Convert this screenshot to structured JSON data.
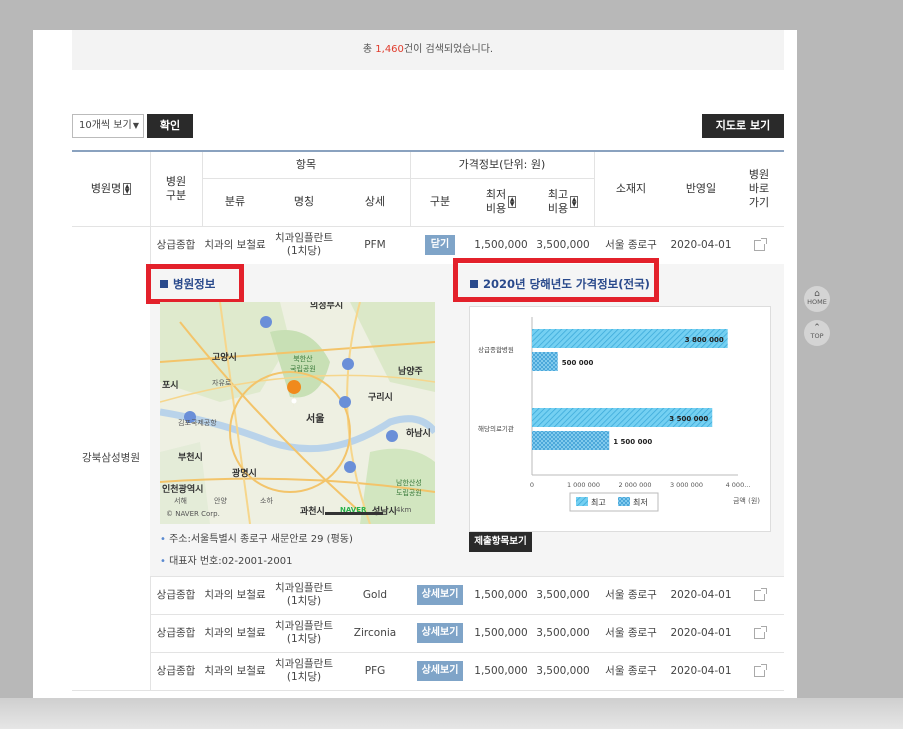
{
  "summary": {
    "prefix": "총 ",
    "count": "1,460",
    "suffix": "건이 검색되었습니다."
  },
  "toolbar": {
    "select_value": "10개씩 보기",
    "confirm_label": "확인",
    "map_view_label": "지도로 보기"
  },
  "table": {
    "headers": {
      "hospital": "병원명",
      "type": "병원\n구분",
      "item": "항목",
      "category": "분류",
      "name": "명칭",
      "detail": "상세",
      "price_info": "가격정보(단위: 원)",
      "division": "구분",
      "min": "최저\n비용",
      "max": "최고\n비용",
      "location": "소재지",
      "date": "반영일",
      "link": "병원\n바로\n가기"
    },
    "hospital_name": "강북삼성병원",
    "rows": [
      {
        "type": "상급종합",
        "category": "치과의 보철료",
        "name": "치과임플란트\n(1치당)",
        "detail": "PFM",
        "button": "닫기",
        "min": "1,500,000",
        "max": "3,500,000",
        "location": "서울 종로구",
        "date": "2020-04-01"
      },
      {
        "type": "상급종합",
        "category": "치과의 보철료",
        "name": "치과임플란트\n(1치당)",
        "detail": "Gold",
        "button": "상세보기",
        "min": "1,500,000",
        "max": "3,500,000",
        "location": "서울 종로구",
        "date": "2020-04-01"
      },
      {
        "type": "상급종합",
        "category": "치과의 보철료",
        "name": "치과임플란트\n(1치당)",
        "detail": "Zirconia",
        "button": "상세보기",
        "min": "1,500,000",
        "max": "3,500,000",
        "location": "서울 종로구",
        "date": "2020-04-01"
      },
      {
        "type": "상급종합",
        "category": "치과의 보철료",
        "name": "치과임플란트\n(1치당)",
        "detail": "PFG",
        "button": "상세보기",
        "min": "1,500,000",
        "max": "3,500,000",
        "location": "서울 종로구",
        "date": "2020-04-01"
      }
    ]
  },
  "panel": {
    "hospital_info_title": "병원정보",
    "price_title": "2020년 당해년도 가격정보(전국)",
    "address": "주소:서울특별시 종로구 새문안로 29 (평동)",
    "phone": "대표자 번호:02-2001-2001",
    "submit_button": "제출항목보기",
    "map_labels": {
      "top": "의정부시",
      "goyang": "고양시",
      "bukhansan": "북한산\n국립공원",
      "namyang": "남양주",
      "gimpo": "포시",
      "jayuro": "자유로",
      "guri": "구리시",
      "seoul": "서울",
      "airport": "김포국제공항",
      "hanam": "하남시",
      "bucheon": "부천시",
      "gwangmyeong": "광명시",
      "incheon": "인천광역시",
      "namhan": "남한산성\n도립공원",
      "seohae": "서해",
      "anyang": "안양",
      "siheung": "소하",
      "gwacheon": "과천시",
      "seongnam": "성남시",
      "copyright": "© NAVER Corp.",
      "naver": "NAVER",
      "scale": "4km"
    }
  },
  "chart_data": {
    "type": "bar",
    "orientation": "horizontal",
    "categories": [
      "상급종합병원",
      "해당의료기관"
    ],
    "series": [
      {
        "name": "최고",
        "values": [
          3800000,
          3500000
        ],
        "color": "#5cc8f0"
      },
      {
        "name": "최저",
        "values": [
          500000,
          1500000
        ],
        "color": "#5cc8f0"
      }
    ],
    "value_labels": [
      [
        "3 800 000",
        "500 000"
      ],
      [
        "3 500 000",
        "1 500 000"
      ]
    ],
    "xticks": [
      "0",
      "1 000 000",
      "2 000 000",
      "3 000 000",
      "4 000..."
    ],
    "xlim": [
      0,
      4000000
    ],
    "xlabel": "금액 (원)",
    "legend": "bottom"
  },
  "side": {
    "home": "HOME",
    "top": "TOP"
  }
}
